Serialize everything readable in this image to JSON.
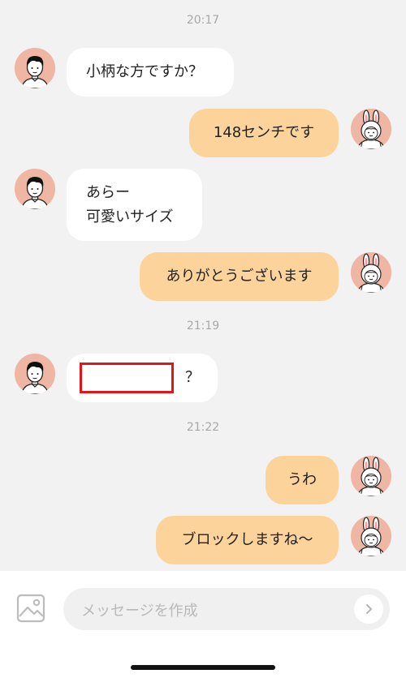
{
  "timestamps": [
    "20:17",
    "21:19",
    "21:22"
  ],
  "messages": [
    {
      "text": "小柄な方ですか？"
    },
    {
      "text": "148センチです"
    },
    {
      "line1": "あらー",
      "line2": "可愛いサイズ"
    },
    {
      "text": "ありがとうございます"
    },
    {
      "suffix": "？"
    },
    {
      "text": "うわ"
    },
    {
      "text": "ブロックしますね〜"
    }
  ],
  "composer": {
    "placeholder": "メッセージを作成"
  },
  "icons": {
    "image_button": "image-icon",
    "send_button": "chevron-right-icon",
    "partner_avatar": "man-avatar-icon",
    "self_avatar": "bunny-avatar-icon"
  },
  "colors": {
    "background": "#f2f2f2",
    "incoming_bubble": "#ffffff",
    "outgoing_bubble": "#fdd39c",
    "avatar_bg": "#efb6a3",
    "redaction_border": "#e0161b"
  }
}
